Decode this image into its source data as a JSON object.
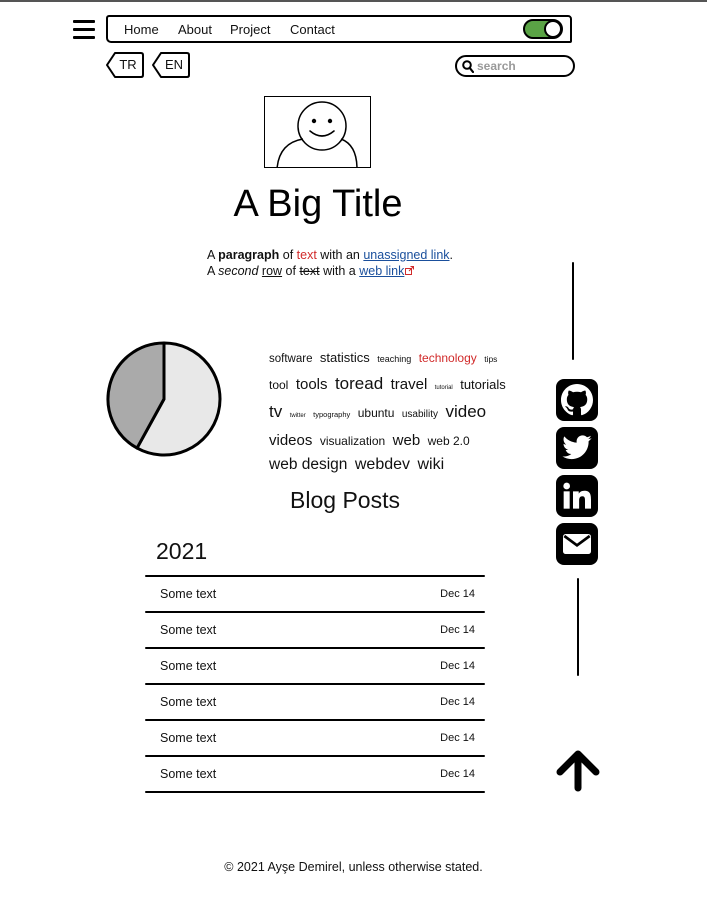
{
  "nav": {
    "links": [
      "Home",
      "About",
      "Project",
      "Contact"
    ],
    "toggle_on": true,
    "toggle_color": "#5aa345"
  },
  "languages": [
    "TR",
    "EN"
  ],
  "search": {
    "placeholder": "search",
    "value": ""
  },
  "hero": {
    "title": "A Big Title"
  },
  "paragraph": {
    "l1_a": "A ",
    "l1_bold": "paragraph",
    "l1_b": " of ",
    "l1_red": "text",
    "l1_c": " with an ",
    "l1_link": "unassigned link",
    "l1_d": ".",
    "l2_a": "A ",
    "l2_italic": "second",
    "l2_b": " ",
    "l2_under": "row",
    "l2_c": " of ",
    "l2_strike": "text",
    "l2_d": " with a ",
    "l2_link": "web link"
  },
  "pie_data": {
    "type": "pie",
    "values": [
      58,
      42
    ],
    "colors": [
      "#e8e8e8",
      "#aaaaaa"
    ]
  },
  "tags": [
    {
      "text": "software",
      "size": 11.5
    },
    {
      "text": "statistics",
      "size": 13
    },
    {
      "text": "teaching",
      "size": 9
    },
    {
      "text": "technology",
      "size": 12,
      "color": "#d12a2a"
    },
    {
      "text": "tips",
      "size": 8.5
    },
    {
      "text": "tool",
      "size": 12
    },
    {
      "text": "tools",
      "size": 15
    },
    {
      "text": "toread",
      "size": 17
    },
    {
      "text": "travel",
      "size": 15
    },
    {
      "text": "tutorial",
      "size": 6
    },
    {
      "text": "tutorials",
      "size": 13
    },
    {
      "text": "tv",
      "size": 17
    },
    {
      "text": "twitter",
      "size": 6
    },
    {
      "text": "typography",
      "size": 7.5
    },
    {
      "text": "ubuntu",
      "size": 12
    },
    {
      "text": "usability",
      "size": 10
    },
    {
      "text": "video",
      "size": 17
    },
    {
      "text": "videos",
      "size": 15
    },
    {
      "text": "visualization",
      "size": 12
    },
    {
      "text": "web",
      "size": 15
    },
    {
      "text": "web 2.0",
      "size": 12
    },
    {
      "text": "web design",
      "size": 15.5
    },
    {
      "text": "webdev",
      "size": 16
    },
    {
      "text": "wiki",
      "size": 16
    }
  ],
  "blog": {
    "heading": "Blog Posts",
    "year": "2021",
    "posts": [
      {
        "text": "Some text",
        "date": "Dec 14"
      },
      {
        "text": "Some text",
        "date": "Dec 14"
      },
      {
        "text": "Some text",
        "date": "Dec 14"
      },
      {
        "text": "Some text",
        "date": "Dec 14"
      },
      {
        "text": "Some text",
        "date": "Dec 14"
      },
      {
        "text": "Some text",
        "date": "Dec 14"
      }
    ]
  },
  "social": [
    "github-icon",
    "twitter-icon",
    "linkedin-icon",
    "email-icon"
  ],
  "footer": "© 2021 Ayşe Demirel, unless otherwise stated."
}
